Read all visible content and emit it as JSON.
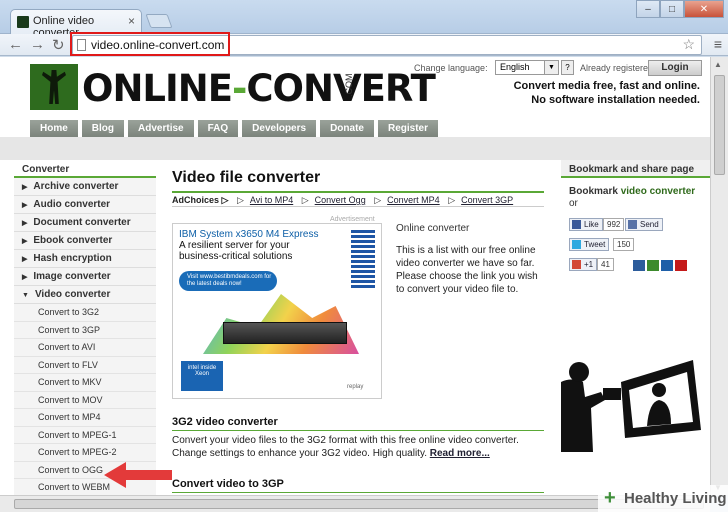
{
  "browser": {
    "tab_title": "Online video converter",
    "tab_close": "×",
    "url": "video.online-convert.com"
  },
  "header": {
    "logo_online": "ONLINE",
    "logo_dash": "-",
    "logo_convert": "CONVERT",
    "logo_dotcom": ".COM",
    "change_language": "Change language:",
    "language": "English",
    "already_registered": "Already registered?",
    "login": "Login",
    "tagline_1": "Convert media free, fast and online.",
    "tagline_2": "No software installation needed."
  },
  "menu": [
    "Home",
    "Blog",
    "Advertise",
    "FAQ",
    "Developers",
    "Donate",
    "Register"
  ],
  "sidebar": {
    "title": "Converter",
    "categories": [
      {
        "label": "Archive converter",
        "arrow": "▶"
      },
      {
        "label": "Audio converter",
        "arrow": "▶"
      },
      {
        "label": "Document converter",
        "arrow": "▶"
      },
      {
        "label": "Ebook converter",
        "arrow": "▶"
      },
      {
        "label": "Hash encryption",
        "arrow": "▶"
      },
      {
        "label": "Image converter",
        "arrow": "▶"
      },
      {
        "label": "Video converter",
        "arrow": "▼"
      }
    ],
    "sub_items": [
      "Convert to 3G2",
      "Convert to 3GP",
      "Convert to AVI",
      "Convert to FLV",
      "Convert to MKV",
      "Convert to MOV",
      "Convert to MP4",
      "Convert to MPEG-1",
      "Convert to MPEG-2",
      "Convert to OGG",
      "Convert to WEBM"
    ]
  },
  "main": {
    "title": "Video file converter",
    "adchoices": "AdChoices ▷",
    "quick_links": [
      "Avi to MP4",
      "Convert Ogg",
      "Convert MP4",
      "Convert 3GP"
    ],
    "advertisement_label": "Advertisement",
    "ad": {
      "headline": "IBM System x3650 M4 Express",
      "subline": "A resilient server for your business-critical solutions",
      "cta": "Visit www.bestibmdeals.com for the latest deals now!",
      "intel": "intel inside Xeon",
      "replay": "replay"
    },
    "online_converter_heading": "Online converter",
    "online_converter_text": "This is a list with our free online video converter we have so far. Please choose the link you wish to convert your video file to.",
    "section_3g2_title": "3G2 video converter",
    "section_3g2_text": "Convert your video files to the 3G2 format with this free online video converter. Change settings to enhance your 3G2 video. High quality.",
    "read_more": "Read more...",
    "section_3gp_title": "Convert video to 3GP"
  },
  "rightcol": {
    "title": "Bookmark and share page",
    "bookmark_prefix": "Bookmark ",
    "bookmark_strong": "video converter",
    "bookmark_or": "or",
    "like_label": "Like",
    "like_count": "992",
    "send_label": "Send",
    "tweet_label": "Tweet",
    "tweet_count": "150",
    "gplus_label": "+1",
    "gplus_count": "41"
  },
  "watermark": {
    "plus": "+",
    "text": "Healthy Living"
  },
  "colors": {
    "accent_green": "#5aa836",
    "highlight_red": "#e01919",
    "arrow_red": "#e33a3a"
  }
}
